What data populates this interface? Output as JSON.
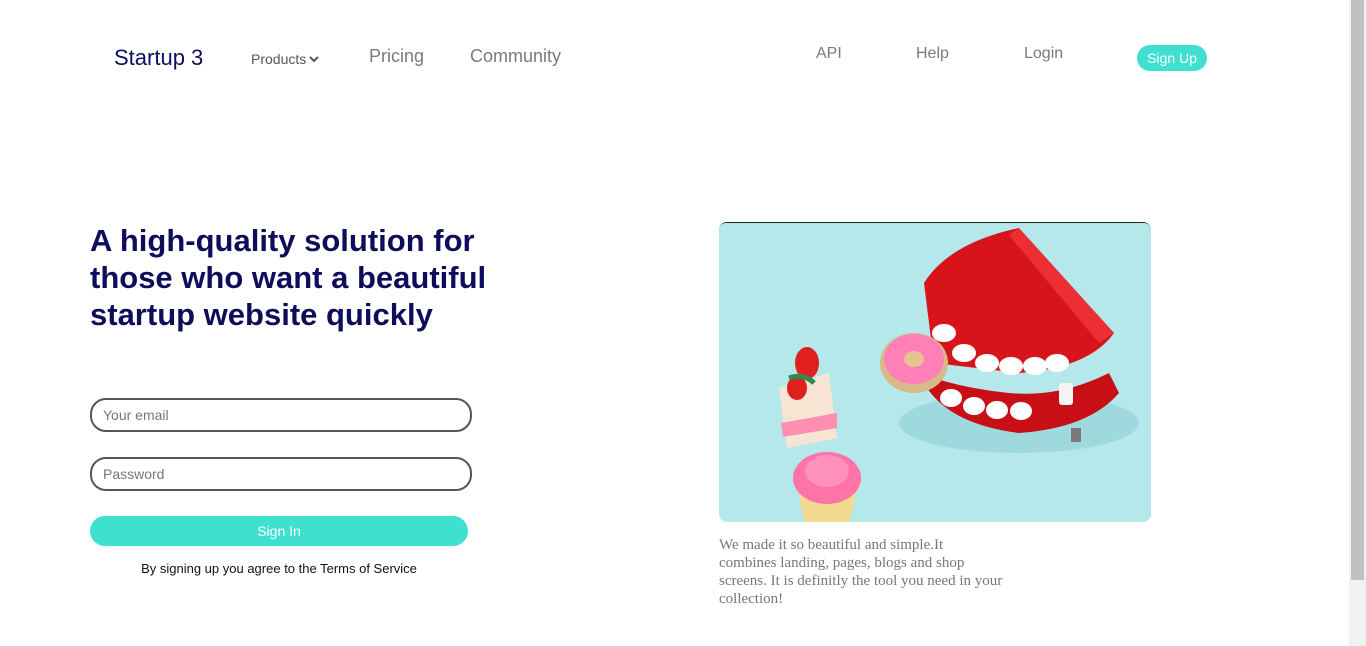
{
  "header": {
    "brand": "Startup 3",
    "nav": {
      "products": "Products",
      "pricing": "Pricing",
      "community": "Community"
    },
    "right": {
      "api": "API",
      "help": "Help",
      "login": "Login",
      "signup": "Sign Up"
    }
  },
  "hero": {
    "title": "A high-quality solution for those who want a beautiful startup website quickly",
    "email_placeholder": "Your email",
    "password_placeholder": "Password",
    "signin_label": "Sign In",
    "terms": "By signing up you agree to the Terms of Service"
  },
  "feature": {
    "image_icon": "wind-up-teeth-toy-photo",
    "caption": "We made it so beautiful and simple.It combines landing, pages, blogs and shop screens. It is definitly the tool you need in your collection!"
  },
  "colors": {
    "accent": "#40e0d0",
    "brand_navy": "#0d0d5c",
    "muted_text": "#7a7a7a"
  }
}
